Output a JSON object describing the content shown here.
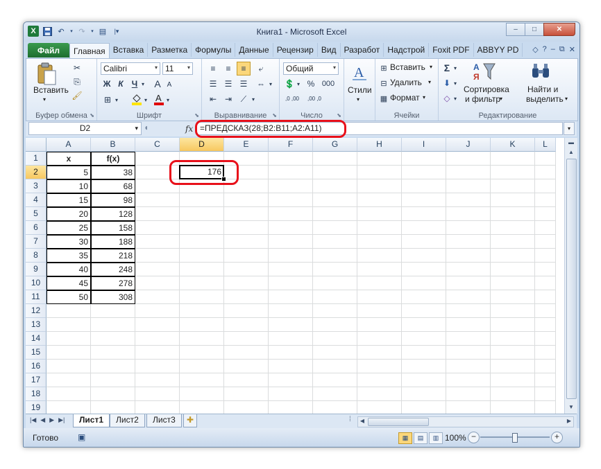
{
  "window": {
    "title": "Книга1 - Microsoft Excel",
    "minimize": "–",
    "maximize": "□",
    "close": "✕"
  },
  "qat": {
    "app_icon": "X",
    "save_icon": "save-icon",
    "undo_icon": "undo-icon",
    "redo_icon": "redo-icon"
  },
  "tabs": {
    "file": "Файл",
    "items": [
      "Главная",
      "Вставка",
      "Разметка",
      "Формулы",
      "Данные",
      "Рецензир",
      "Вид",
      "Разработ",
      "Надстрой",
      "Foxit PDF",
      "ABBYY PD"
    ],
    "active": "Главная"
  },
  "ribbon": {
    "clipboard": {
      "label": "Буфер обмена",
      "paste": "Вставить"
    },
    "font": {
      "label": "Шрифт",
      "name": "Calibri",
      "size": "11",
      "bold": "Ж",
      "italic": "К",
      "underline": "Ч",
      "grow": "A",
      "shrink": "A"
    },
    "alignment": {
      "label": "Выравнивание"
    },
    "number": {
      "label": "Число",
      "format": "Общий",
      "percent": "%",
      "thousands": "000",
      "inc": ",0 ,00",
      "dec": ",00 ,0"
    },
    "styles": {
      "label": "Стили",
      "button": "Стили"
    },
    "cells": {
      "label": "Ячейки",
      "insert": "Вставить",
      "delete": "Удалить",
      "format": "Формат"
    },
    "editing": {
      "label": "Редактирование",
      "sigma": "Σ",
      "sort": "Сортировка\nи фильтр",
      "sort1": "Сортировка",
      "sort2": "и фильтр",
      "find1": "Найти и",
      "find2": "выделить"
    }
  },
  "formula_bar": {
    "name_box": "D2",
    "fx": "fx",
    "formula": "=ПРЕДСКАЗ(28;B2:B11;A2:A11)"
  },
  "columns": [
    "A",
    "B",
    "C",
    "D",
    "E",
    "F",
    "G",
    "H",
    "I",
    "J",
    "K",
    "L"
  ],
  "rows": [
    "1",
    "2",
    "3",
    "4",
    "5",
    "6",
    "7",
    "8",
    "9",
    "10",
    "11",
    "12",
    "13",
    "14",
    "15",
    "16",
    "17",
    "18",
    "19"
  ],
  "table": {
    "headers": [
      "x",
      "f(x)"
    ],
    "data": [
      [
        "5",
        "38"
      ],
      [
        "10",
        "68"
      ],
      [
        "15",
        "98"
      ],
      [
        "20",
        "128"
      ],
      [
        "25",
        "158"
      ],
      [
        "30",
        "188"
      ],
      [
        "35",
        "218"
      ],
      [
        "40",
        "248"
      ],
      [
        "45",
        "278"
      ],
      [
        "50",
        "308"
      ]
    ]
  },
  "active_cell": {
    "ref": "D2",
    "value": "176"
  },
  "sheets": {
    "tabs": [
      "Лист1",
      "Лист2",
      "Лист3"
    ],
    "active": "Лист1"
  },
  "status": {
    "ready": "Готово",
    "zoom": "100%",
    "minus": "−",
    "plus": "+"
  },
  "highlight_color": "#e8101a"
}
